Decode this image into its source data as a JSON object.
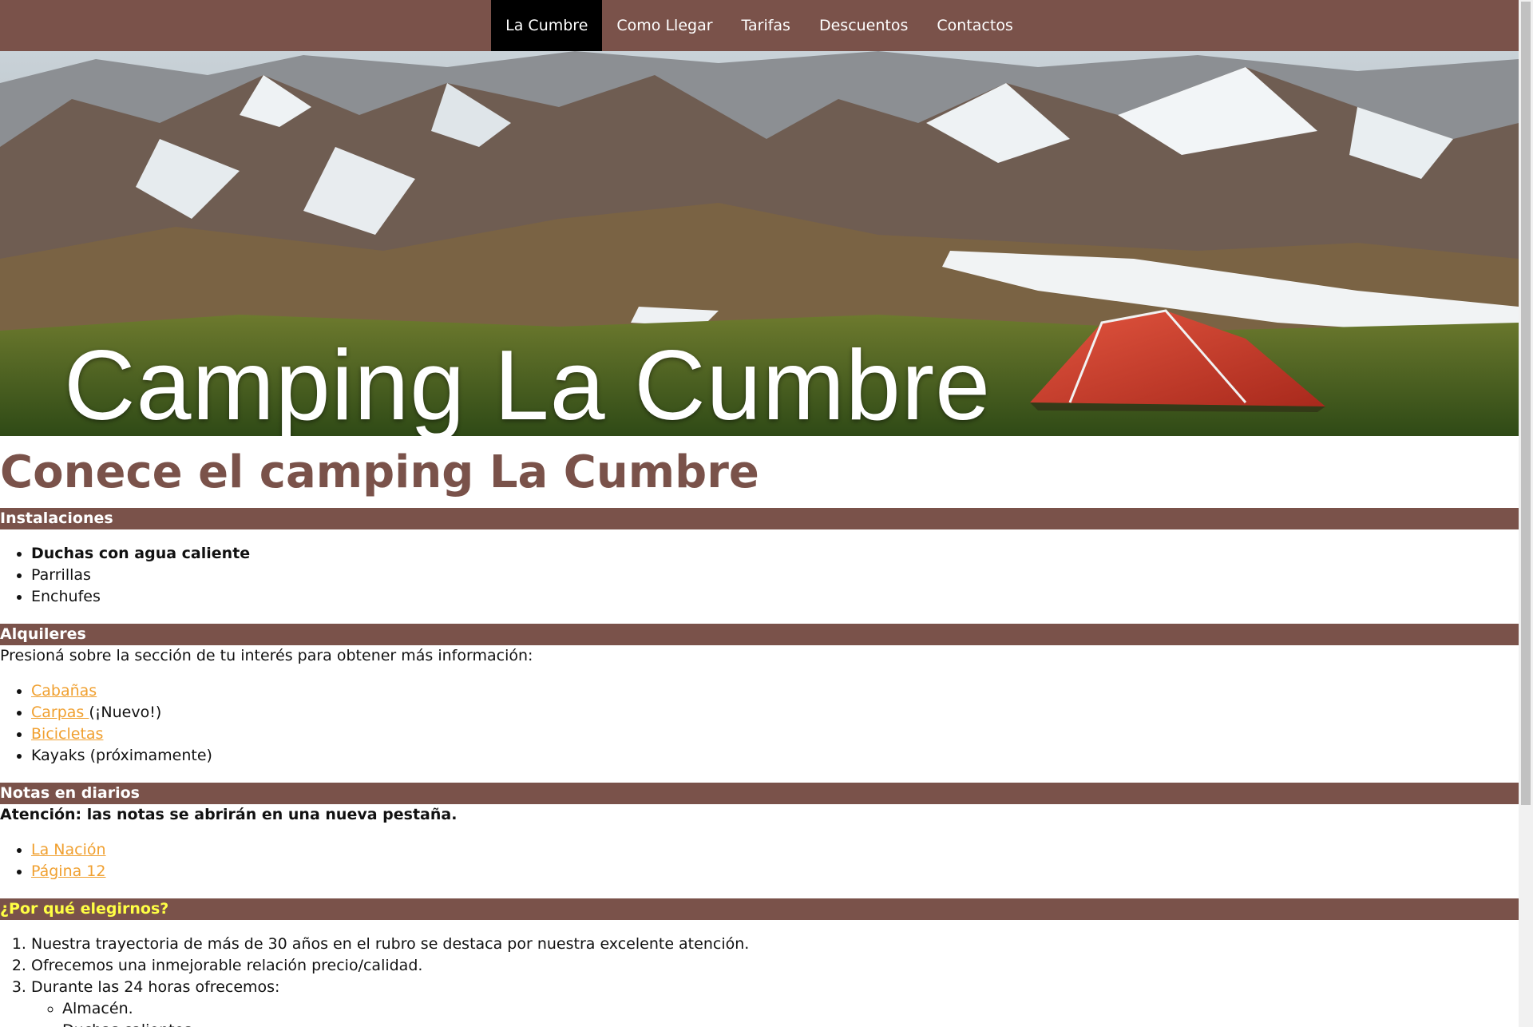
{
  "nav": {
    "items": [
      {
        "label": "La Cumbre",
        "active": true
      },
      {
        "label": "Como Llegar",
        "active": false
      },
      {
        "label": "Tarifas",
        "active": false
      },
      {
        "label": "Descuentos",
        "active": false
      },
      {
        "label": "Contactos",
        "active": false
      }
    ]
  },
  "hero": {
    "title": "Camping La Cumbre"
  },
  "main": {
    "heading": "Conece el camping La Cumbre",
    "instalaciones": {
      "title": "Instalaciones",
      "items": [
        "Duchas con agua caliente",
        "Parrillas",
        "Enchufes"
      ]
    },
    "alquileres": {
      "title": "Alquileres",
      "intro": "Presioná sobre la sección de tu interés para obtener más información:",
      "items": [
        {
          "link": "Cabañas",
          "suffix": ""
        },
        {
          "link": "Carpas ",
          "suffix": "(¡Nuevo!)"
        },
        {
          "link": "Bicicletas",
          "suffix": ""
        },
        {
          "link": "",
          "suffix": "Kayaks (próximamente)"
        }
      ]
    },
    "notas": {
      "title": "Notas en diarios",
      "warning": "Atención: las notas se abrirán en una nueva pestaña.",
      "items": [
        "La Nación",
        "Página 12"
      ]
    },
    "porque": {
      "title": "¿Por qué elegirnos?",
      "items": [
        "Nuestra trayectoria de más de 30 años en el rubro se destaca por nuestra excelente atención.",
        "Ofrecemos una inmejorable relación precio/calidad.",
        "Durante las 24 horas ofrecemos:"
      ],
      "subitems": [
        "Almacén.",
        "Duchas calientes."
      ]
    }
  },
  "colors": {
    "brand": "#7a524a",
    "link": "#f0a030",
    "highlight": "#ffff44"
  }
}
